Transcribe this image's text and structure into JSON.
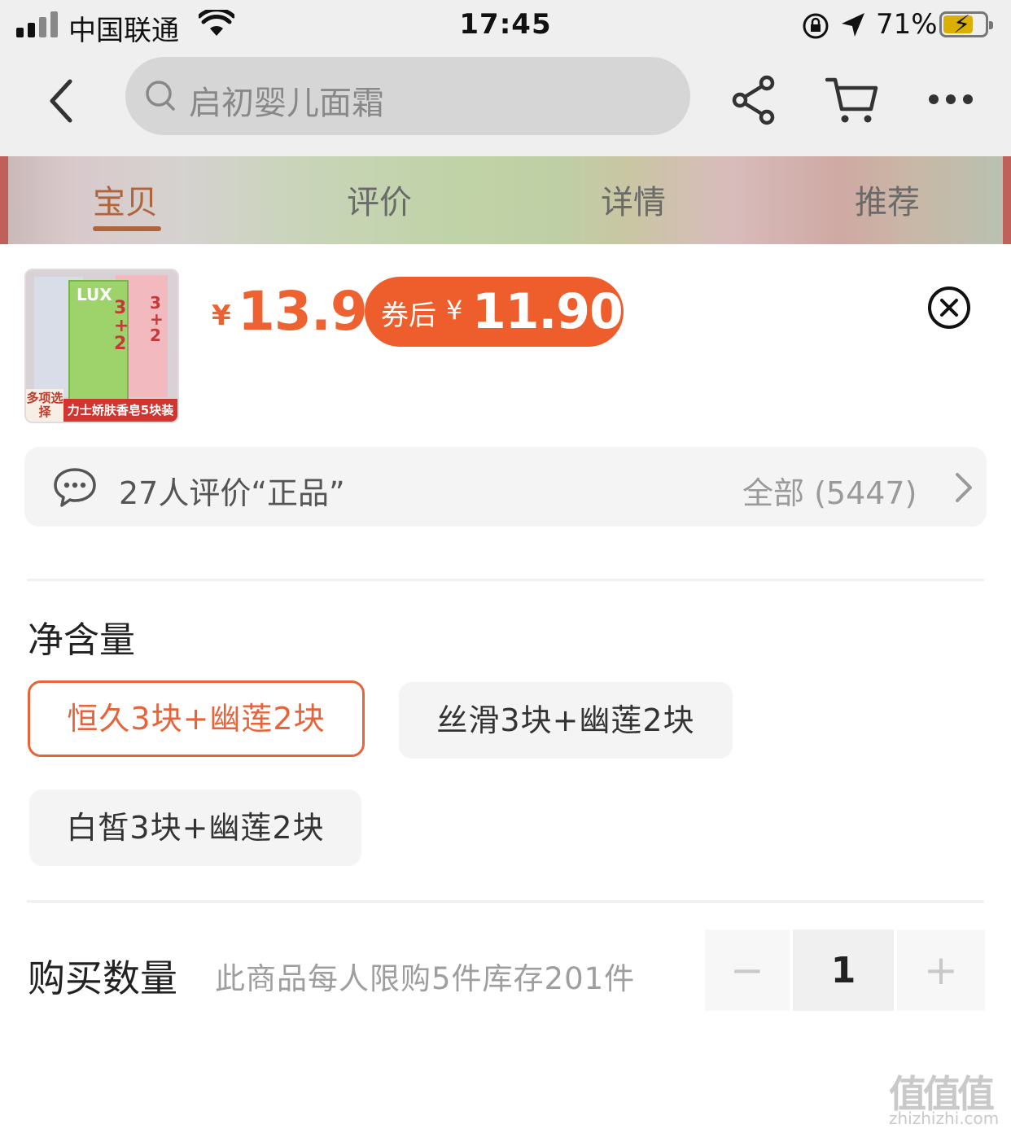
{
  "status_bar": {
    "carrier": "中国联通",
    "time": "17:45",
    "battery": "71%"
  },
  "nav": {
    "search_placeholder": "启初婴儿面霜",
    "icons": [
      "back-icon",
      "search-icon",
      "share-icon",
      "cart-icon",
      "more-icon"
    ]
  },
  "tabs": [
    {
      "label": "宝贝",
      "active": true
    },
    {
      "label": "评价",
      "active": false
    },
    {
      "label": "详情",
      "active": false
    },
    {
      "label": "推荐",
      "active": false
    }
  ],
  "product": {
    "thumbnail": {
      "corner_tag": "多项选择",
      "ribbon_text": "力士娇肤香皂5块装"
    },
    "currency_symbol": "¥",
    "price": "13.9",
    "coupon": {
      "label": "券后",
      "currency_symbol": "¥",
      "price": "11.90"
    }
  },
  "review": {
    "summary": "27人评价“正品”",
    "all_label": "全部 (5447)"
  },
  "spec": {
    "title": "净含量",
    "options": [
      {
        "label": "恒久3块+幽莲2块",
        "selected": true
      },
      {
        "label": "丝滑3块+幽莲2块",
        "selected": false
      },
      {
        "label": "白皙3块+幽莲2块",
        "selected": false
      }
    ]
  },
  "quantity": {
    "title": "购买数量",
    "hint": "此商品每人限购5件库存201件",
    "value": "1",
    "minus": "−",
    "plus": "+"
  },
  "watermark": {
    "main": "值值值",
    "sub": "zhizhizhi.com"
  },
  "colors": {
    "accent": "#ee6130",
    "coupon_bg": "#ee5e2d",
    "selected_border": "#e7633a"
  }
}
